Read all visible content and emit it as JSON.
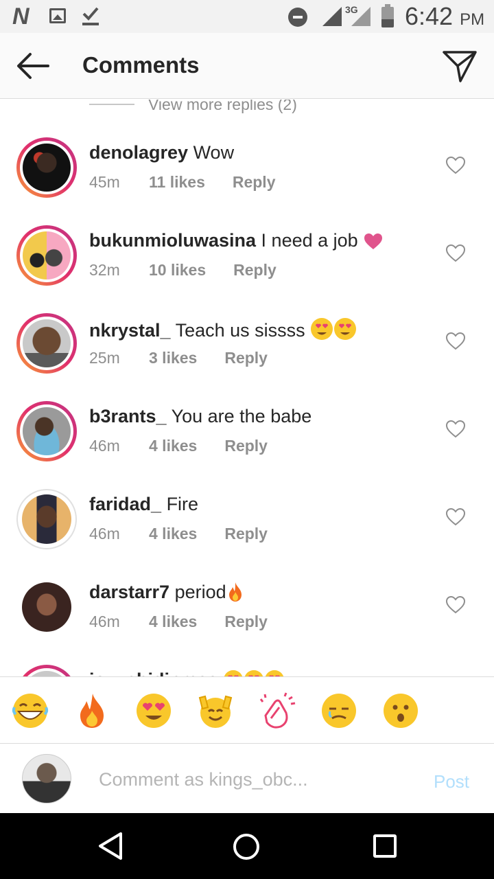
{
  "status_bar": {
    "time": "6:42",
    "ampm": "PM",
    "network": "3G"
  },
  "header": {
    "title": "Comments"
  },
  "view_more": "View more replies (2)",
  "comments": [
    {
      "user": "denolagrey",
      "text": "Wow",
      "time": "45m",
      "likes": "11 likes",
      "reply": "Reply",
      "avatar": "dark"
    },
    {
      "user": "bukunmioluwasina",
      "text": "I need a job ",
      "time": "32m",
      "likes": "10 likes",
      "reply": "Reply",
      "avatar": "poster",
      "emoji": "pink-heart"
    },
    {
      "user": "nkrystal_",
      "text": "Teach us sissss ",
      "time": "25m",
      "likes": "3 likes",
      "reply": "Reply",
      "avatar": "smile",
      "emoji": "heart-eyes x2"
    },
    {
      "user": "b3rants_",
      "text": "You are the babe",
      "time": "46m",
      "likes": "4 likes",
      "reply": "Reply",
      "avatar": "sitting"
    },
    {
      "user": "faridad_",
      "text": "Fire",
      "time": "46m",
      "likes": "4 likes",
      "reply": "Reply",
      "avatar": "selfie"
    },
    {
      "user": "darstarr7",
      "text": "period",
      "time": "46m",
      "likes": "4 likes",
      "reply": "Reply",
      "avatar": "portrait",
      "emoji": "fire"
    },
    {
      "user": "joy_chidinmaa",
      "text": "",
      "time": "",
      "likes": "",
      "reply": "",
      "avatar": "partial",
      "emoji": "heart-eyes x3"
    }
  ],
  "emoji_bar": [
    "grinning-face-icon",
    "fire-icon",
    "heart-eyes-icon",
    "raising-hands-face-icon",
    "clapping-hands-icon",
    "sad-face-icon",
    "surprised-face-icon"
  ],
  "compose": {
    "placeholder": "Comment as kings_obc...",
    "post_label": "Post"
  },
  "colors": {
    "accent": "#3897f0",
    "post_disabled": "#b2dffc",
    "ring_start": "#f9a134",
    "ring_end": "#c13584"
  }
}
